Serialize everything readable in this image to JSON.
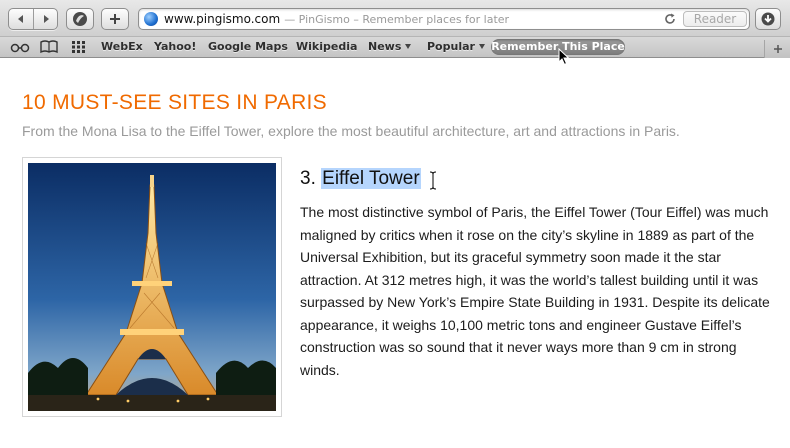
{
  "toolbar": {
    "url": "www.pingismo.com",
    "page_title_suffix": "— PinGismo – Remember places for later",
    "reader_label": "Reader"
  },
  "bookmarks": {
    "items": [
      {
        "label": "WebEx"
      },
      {
        "label": "Yahoo!"
      },
      {
        "label": "Google Maps"
      },
      {
        "label": "Wikipedia"
      },
      {
        "label": "News"
      },
      {
        "label": "Popular"
      },
      {
        "label": "Remember This Place"
      }
    ]
  },
  "article": {
    "title": "10 MUST-SEE SITES IN PARIS",
    "subtitle": "From the Mona Lisa to the Eiffel Tower, explore the most beautiful architecture, art and attractions in Paris.",
    "item_number": "3.",
    "item_name": "Eiffel Tower",
    "item_body": "The most distinctive symbol of Paris, the Eiffel Tower (Tour Eiffel) was much maligned by critics when it rose on the city’s skyline in 1889 as part of the Universal Exhibition, but its graceful symmetry soon made it the star attraction. At 312 metres high, it was the world’s tallest building until it was surpassed by New York’s Empire State Building in 1931. Despite its delicate appearance, it weighs 10,100 metric tons and engineer Gustave Eiffel’s construction was so sound that it never ways more than 9 cm in strong winds."
  },
  "icons": {
    "back": "back-arrow-icon",
    "forward": "forward-arrow-icon",
    "pingismo": "pingismo-icon",
    "add": "add-icon",
    "reload": "reload-icon",
    "downloads": "downloads-icon",
    "reading_list": "reading-list-icon",
    "bookmarks": "bookmarks-book-icon",
    "top_sites": "top-sites-grid-icon",
    "new_tab": "new-tab-plus-icon"
  },
  "colors": {
    "title_orange": "#f06a00",
    "selection": "#b5d5fd"
  }
}
